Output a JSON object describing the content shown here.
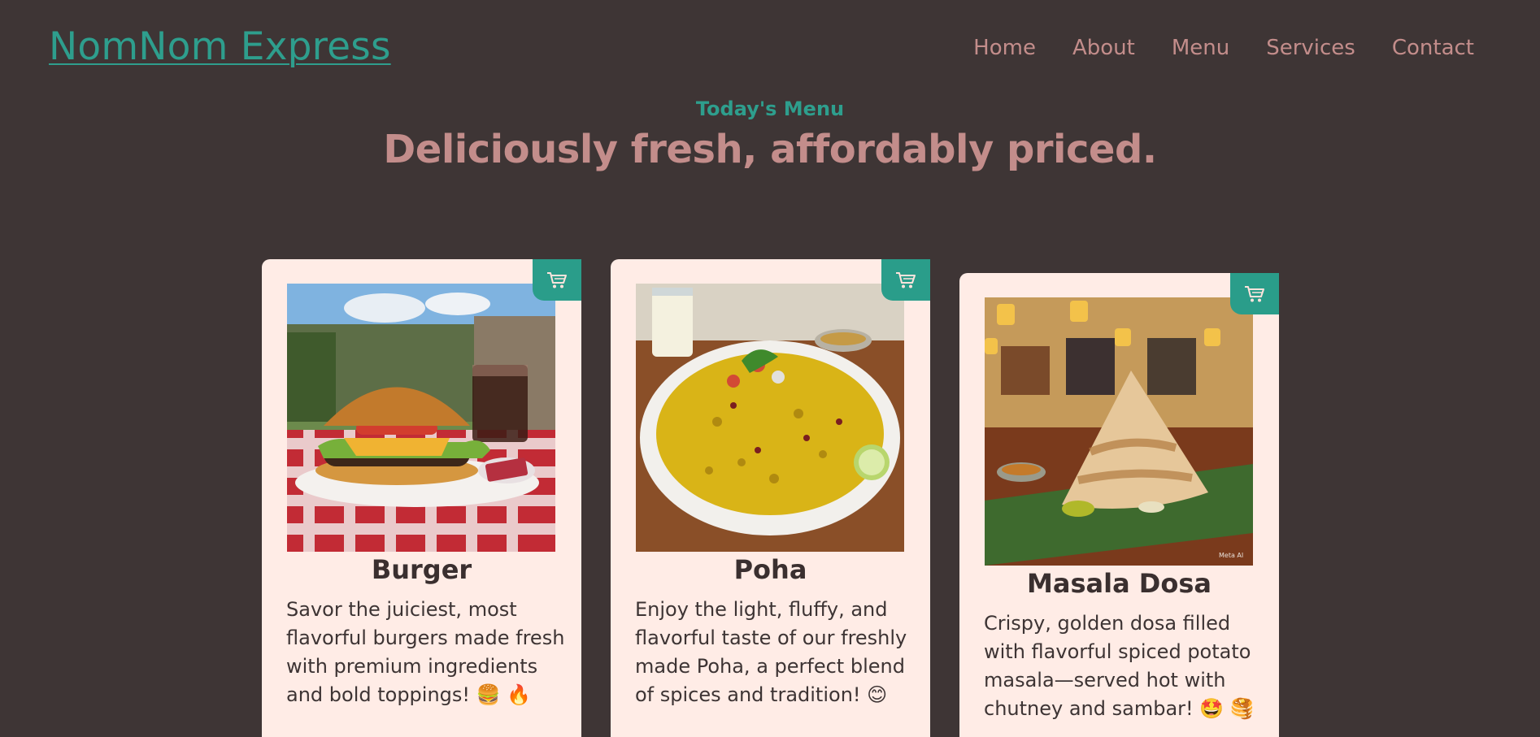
{
  "header": {
    "logo": "NomNom Express",
    "nav": [
      "Home",
      "About",
      "Menu",
      "Services",
      "Contact"
    ]
  },
  "hero": {
    "eyebrow": "Today's Menu",
    "headline": "Deliciously fresh, affordably priced."
  },
  "menu": [
    {
      "title": "Burger",
      "description": "Savor the juiciest, most flavorful burgers made fresh with premium ingredients and bold toppings! 🍔 🔥",
      "image": "burger-photo",
      "cart_icon": "cart-icon"
    },
    {
      "title": "Poha",
      "description": "Enjoy the light, fluffy, and flavorful taste of our freshly made Poha, a perfect blend of spices and tradition! 😊",
      "image": "poha-photo",
      "cart_icon": "cart-icon"
    },
    {
      "title": "Masala Dosa",
      "description": "Crispy, golden dosa filled with flavorful spiced potato masala—served hot with chutney and sambar! 🤩 🥞",
      "image": "masala-dosa-photo",
      "image_caption": "Meta AI",
      "cart_icon": "cart-icon"
    }
  ],
  "colors": {
    "background": "#3e3535",
    "accent_teal": "#2e9e8d",
    "accent_pink": "#c38d8b",
    "card": "#ffece6"
  }
}
